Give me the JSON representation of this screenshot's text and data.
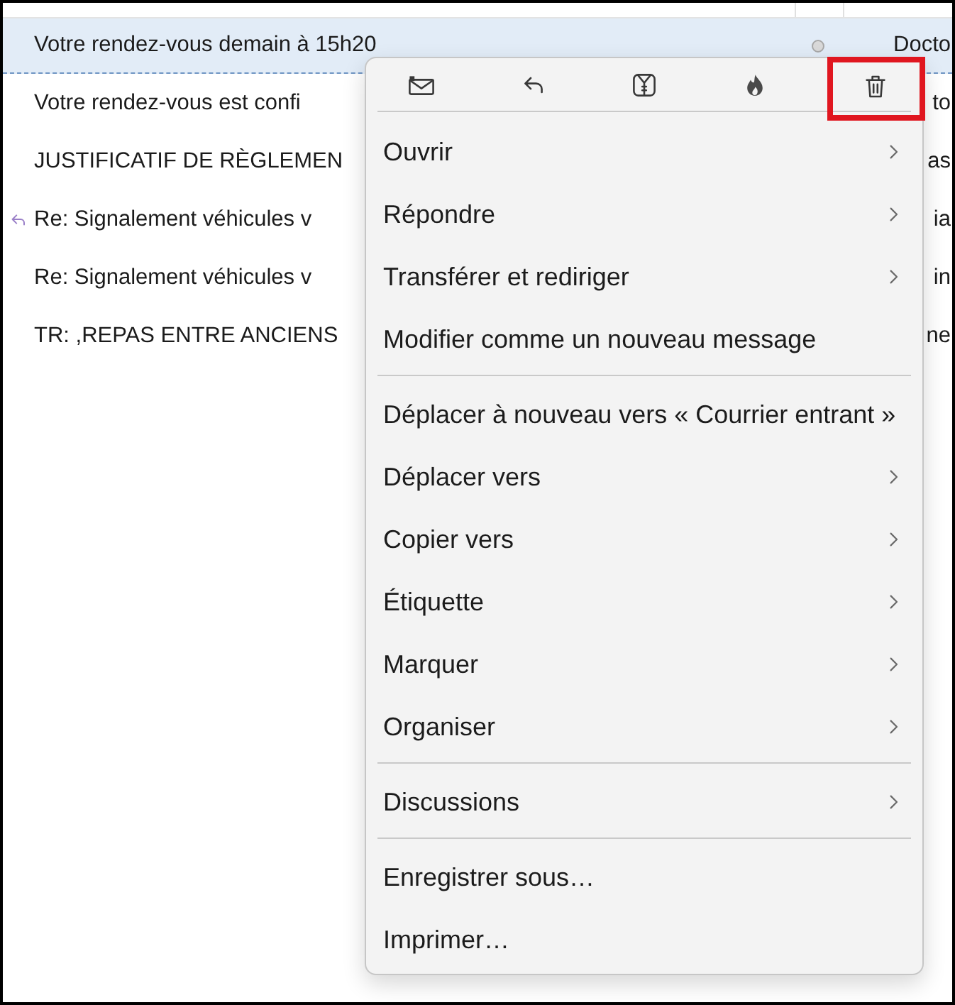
{
  "message_list": {
    "rows": [
      {
        "subject": "Votre rendez-vous demain à 15h20",
        "column_4": "Docto",
        "selected": true,
        "replied": false,
        "status_dot": true
      },
      {
        "subject": "Votre rendez-vous est confi",
        "column_4": "to",
        "selected": false,
        "replied": false,
        "status_dot": false
      },
      {
        "subject": "JUSTIFICATIF DE RÈGLEMEN",
        "column_4": "as",
        "selected": false,
        "replied": false,
        "status_dot": false
      },
      {
        "subject": "Re: Signalement véhicules v",
        "column_4": "ia",
        "selected": false,
        "replied": true,
        "status_dot": false
      },
      {
        "subject": "Re: Signalement véhicules v",
        "column_4": "in",
        "selected": false,
        "replied": false,
        "status_dot": false
      },
      {
        "subject": "TR: ,REPAS ENTRE ANCIENS",
        "column_4": "ne",
        "selected": false,
        "replied": false,
        "status_dot": false
      }
    ]
  },
  "context_menu": {
    "toolbar": [
      {
        "kind": "envelope",
        "highlighted": false
      },
      {
        "kind": "reply",
        "highlighted": false
      },
      {
        "kind": "archive",
        "highlighted": false
      },
      {
        "kind": "junk",
        "highlighted": false
      },
      {
        "kind": "delete",
        "highlighted": true
      }
    ],
    "items": [
      {
        "kind": "item",
        "label": "Ouvrir",
        "submenu": true
      },
      {
        "kind": "item",
        "label": "Répondre",
        "submenu": true
      },
      {
        "kind": "item",
        "label": "Transférer et rediriger",
        "submenu": true
      },
      {
        "kind": "item",
        "label": "Modifier comme un nouveau message",
        "submenu": false
      },
      {
        "kind": "separator"
      },
      {
        "kind": "item",
        "label": "Déplacer à nouveau vers « Courrier entrant »",
        "submenu": false
      },
      {
        "kind": "item",
        "label": "Déplacer vers",
        "submenu": true
      },
      {
        "kind": "item",
        "label": "Copier vers",
        "submenu": true
      },
      {
        "kind": "item",
        "label": "Étiquette",
        "submenu": true
      },
      {
        "kind": "item",
        "label": "Marquer",
        "submenu": true
      },
      {
        "kind": "item",
        "label": "Organiser",
        "submenu": true
      },
      {
        "kind": "separator"
      },
      {
        "kind": "item",
        "label": "Discussions",
        "submenu": true
      },
      {
        "kind": "separator"
      },
      {
        "kind": "item",
        "label": "Enregistrer sous…",
        "submenu": false
      },
      {
        "kind": "item",
        "label": "Imprimer…",
        "submenu": false
      }
    ]
  }
}
